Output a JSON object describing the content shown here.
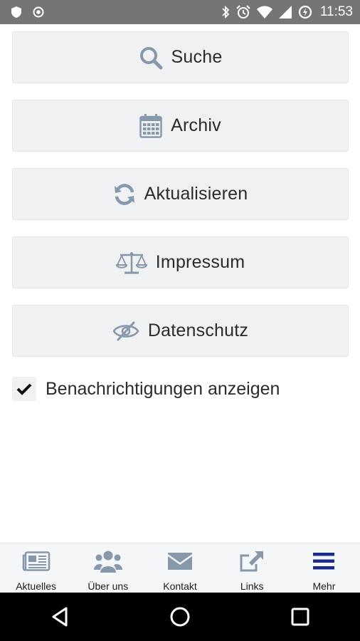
{
  "status_bar": {
    "time": "11:53",
    "left_icons": [
      "shield-icon",
      "target-icon"
    ],
    "right_icons": [
      "bluetooth-icon",
      "alarm-icon",
      "wifi-icon",
      "signal-icon",
      "battery-saver-icon"
    ]
  },
  "menu": {
    "items": [
      {
        "label": "Suche",
        "icon": "search-icon"
      },
      {
        "label": "Archiv",
        "icon": "calendar-icon"
      },
      {
        "label": "Aktualisieren",
        "icon": "refresh-icon"
      },
      {
        "label": "Impressum",
        "icon": "balance-scale-icon"
      },
      {
        "label": "Datenschutz",
        "icon": "eye-slash-icon"
      }
    ]
  },
  "notifications": {
    "label": "Benachrichtigungen anzeigen",
    "checked": true
  },
  "bottom_nav": {
    "items": [
      {
        "label": "Aktuelles",
        "icon": "newspaper-icon"
      },
      {
        "label": "Über uns",
        "icon": "users-icon"
      },
      {
        "label": "Kontakt",
        "icon": "envelope-icon"
      },
      {
        "label": "Links",
        "icon": "external-link-icon"
      },
      {
        "label": "Mehr",
        "icon": "menu-icon",
        "active": true
      }
    ]
  },
  "colors": {
    "status_bar_bg": "#757575",
    "button_bg": "#eff1f3",
    "icon_gray": "#8798ab",
    "active_nav": "#1a2b8c",
    "text": "#2b2b2b"
  }
}
